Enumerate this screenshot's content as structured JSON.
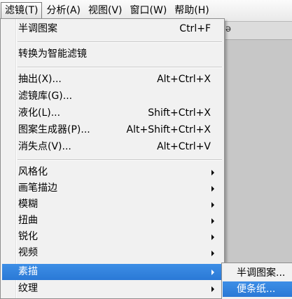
{
  "toolbar_fragment": "ə",
  "menubar": {
    "items": [
      {
        "label": "滤镜(T)"
      },
      {
        "label": "分析(A)"
      },
      {
        "label": "视图(V)"
      },
      {
        "label": "窗口(W)"
      },
      {
        "label": "帮助(H)"
      }
    ]
  },
  "filter_menu": {
    "items": [
      {
        "label": "半调图案",
        "shortcut": "Ctrl+F"
      },
      {
        "label": "转换为智能滤镜",
        "shortcut": ""
      },
      {
        "label": "抽出(X)...",
        "shortcut": "Alt+Ctrl+X"
      },
      {
        "label": "滤镜库(G)...",
        "shortcut": ""
      },
      {
        "label": "液化(L)...",
        "shortcut": "Shift+Ctrl+X"
      },
      {
        "label": "图案生成器(P)...",
        "shortcut": "Alt+Shift+Ctrl+X"
      },
      {
        "label": "消失点(V)...",
        "shortcut": "Alt+Ctrl+V"
      },
      {
        "label": "风格化",
        "shortcut": ""
      },
      {
        "label": "画笔描边",
        "shortcut": ""
      },
      {
        "label": "模糊",
        "shortcut": ""
      },
      {
        "label": "扭曲",
        "shortcut": ""
      },
      {
        "label": "锐化",
        "shortcut": ""
      },
      {
        "label": "视频",
        "shortcut": ""
      },
      {
        "label": "素描",
        "shortcut": ""
      },
      {
        "label": "纹理",
        "shortcut": ""
      }
    ]
  },
  "sketch_submenu": {
    "items": [
      {
        "label": "半调图案..."
      },
      {
        "label": "便条纸..."
      }
    ]
  },
  "colors": {
    "highlight": "#2f80dd",
    "menu_bg": "#f1f1f1"
  }
}
